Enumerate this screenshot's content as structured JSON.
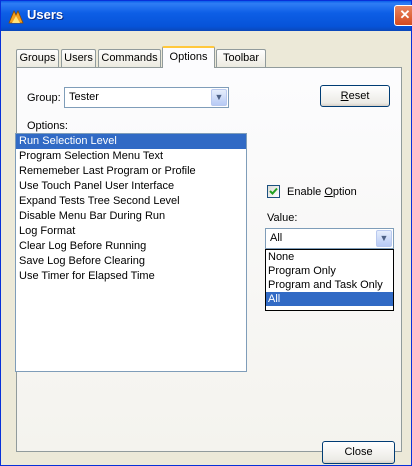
{
  "window": {
    "title": "Users",
    "close_glyph": "✕"
  },
  "tabs": [
    {
      "label": "Groups"
    },
    {
      "label": "Users"
    },
    {
      "label": "Commands"
    },
    {
      "label": "Options"
    },
    {
      "label": "Toolbar"
    }
  ],
  "group": {
    "label": "Group:",
    "value": "Tester"
  },
  "reset_button": {
    "pre": "",
    "accel": "R",
    "post": "eset"
  },
  "options": {
    "label": "Options:",
    "items": [
      "Run Selection Level",
      "Program Selection Menu Text",
      "Rememeber Last Program or Profile",
      "Use Touch Panel User Interface",
      "Expand Tests Tree Second Level",
      "Disable Menu Bar During Run",
      "Log Format",
      "Clear Log Before Running",
      "Save Log Before Clearing",
      "Use Timer for Elapsed Time"
    ],
    "selected_index": 0
  },
  "enable_option": {
    "pre": "Enable ",
    "accel": "O",
    "post": "ption",
    "checked": true
  },
  "value": {
    "label": "Value:",
    "selected": "All",
    "dropdown_options": [
      "None",
      "Program Only",
      "Program and Task Only",
      "All"
    ],
    "highlighted_index": 3
  },
  "close_button": {
    "label": "Close"
  },
  "icons": {
    "app": "users-app-icon",
    "close": "close-icon",
    "dropdown_arrow": "chevron-down-icon",
    "check": "checkmark-icon"
  },
  "colors": {
    "titlebar": "#0653d8",
    "selection": "#316ac5",
    "active_tab_accent": "#ffc83c"
  }
}
